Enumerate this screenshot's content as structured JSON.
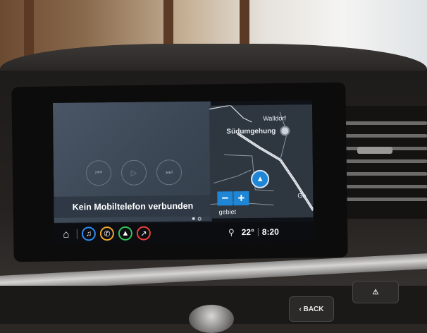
{
  "media": {
    "status_text": "Kein Mobiltelefon verbunden",
    "controls": [
      "previous-track-icon",
      "play-icon",
      "next-track-icon"
    ],
    "page_dots": 2,
    "active_page": 1
  },
  "map": {
    "place_label": "Walldorf",
    "road_label": "Südumgehung",
    "partial_label_right": "Ge",
    "partial_label_bottom": "gebiet",
    "zoom_out": "−",
    "zoom_in": "+",
    "accent": "#1f86d6"
  },
  "status_bar": {
    "temperature": "22°",
    "time": "8:20",
    "icons": [
      "home-icon",
      "music-icon",
      "phone-icon",
      "navigation-icon",
      "connectivity-icon",
      "location-pin-icon"
    ],
    "icon_colors": {
      "music": "#2f8bf2",
      "phone": "#f2a72f",
      "navigation": "#35c45a",
      "connectivity": "#e8413b"
    }
  },
  "hardware": {
    "back_button": "‹ BACK"
  }
}
